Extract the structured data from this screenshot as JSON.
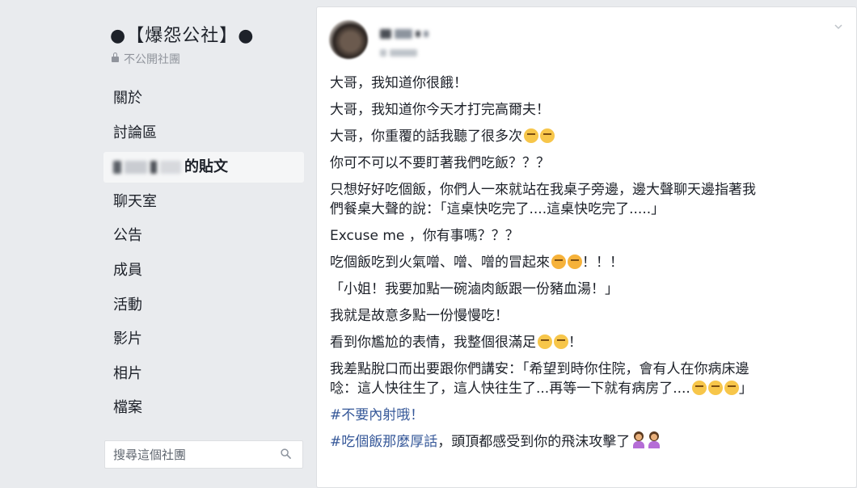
{
  "group": {
    "title": "●【爆怨公社】●",
    "privacy": "不公開社團"
  },
  "nav": {
    "items": [
      {
        "label": "關於"
      },
      {
        "label": "討論區"
      },
      {
        "label": "的貼文",
        "active": true
      },
      {
        "label": "聊天室"
      },
      {
        "label": "公告"
      },
      {
        "label": "成員"
      },
      {
        "label": "活動"
      },
      {
        "label": "影片"
      },
      {
        "label": "相片"
      },
      {
        "label": "檔案"
      }
    ]
  },
  "search": {
    "placeholder": "搜尋這個社團"
  },
  "post": {
    "lines": [
      "大哥，我知道你很餓！",
      "大哥，我知道你今天才打完高爾夫！",
      "大哥，你重覆的話我聽了很多次",
      "你可不可以不要盯著我們吃飯？？？",
      "只想好好吃個飯，你們人一來就站在我桌子旁邊，邊大聲聊天邊指著我",
      "們餐桌大聲的說：「這桌快吃完了....這桌快吃完了.....」",
      "Excuse me ，你有事嗎？？？",
      "吃個飯吃到火氣噌、噌、噌的冒起來",
      "！！！",
      "「小姐！我要加點一碗滷肉飯跟一份豬血湯！」",
      "我就是故意多點一份慢慢吃！",
      "看到你尷尬的表情，我整個很滿足",
      "！",
      "我差點脫口而出要跟你們講安：「希望到時你住院，會有人在你病床邊",
      "唸：這人快往生了，這人快往生了...再等一下就有病房了....",
      "」",
      "#不要內射哦！",
      "#吃個飯那麼厚話",
      "，頭頂都感受到你的飛沫攻擊了"
    ]
  },
  "colors": {
    "background": "#e9ebee",
    "link": "#365899",
    "muted": "#90949c"
  }
}
